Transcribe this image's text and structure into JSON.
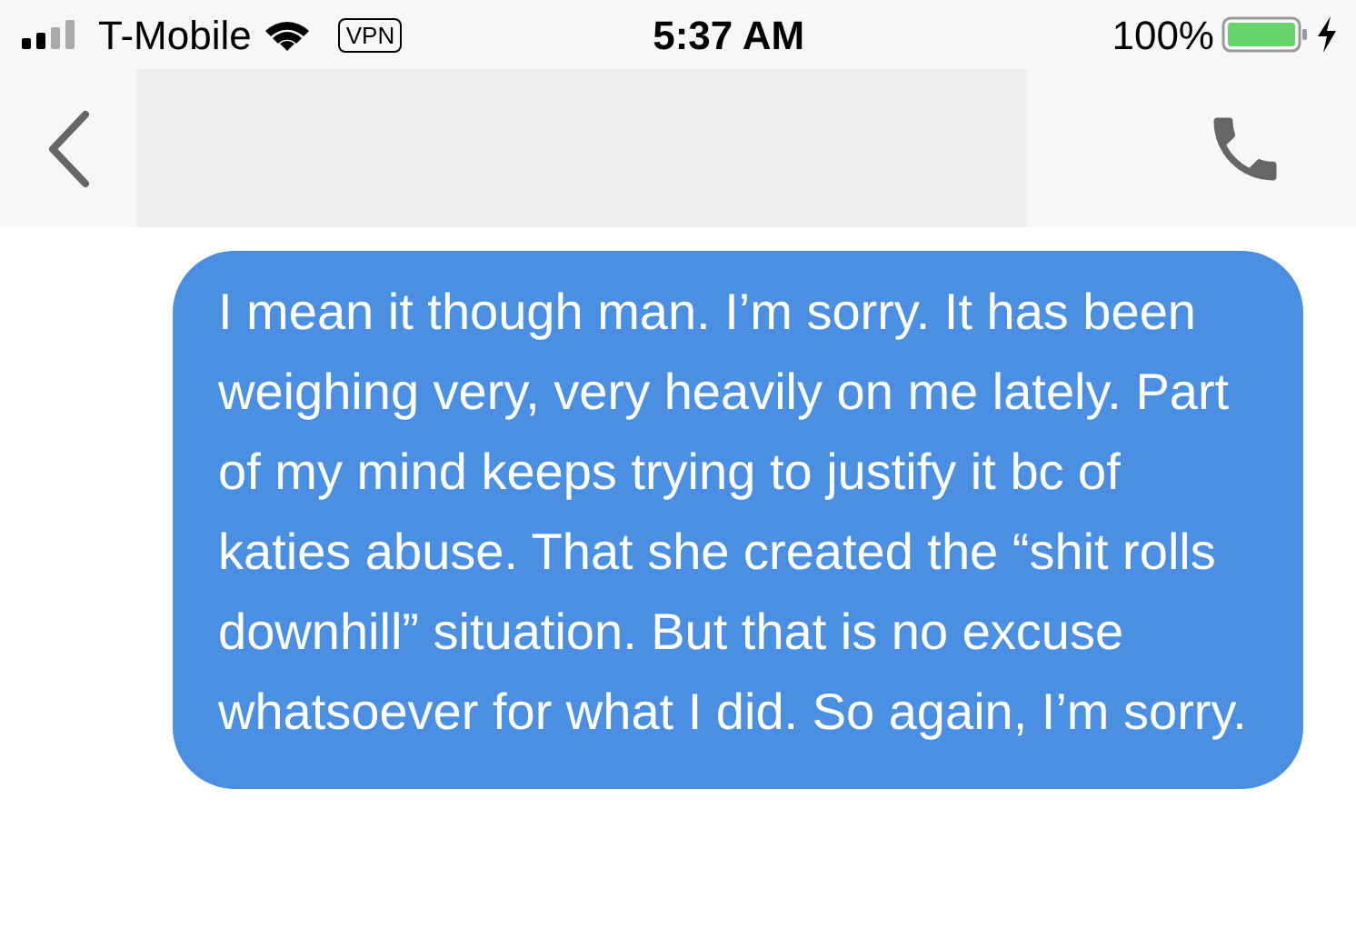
{
  "status_bar": {
    "carrier": "T-Mobile",
    "vpn": "VPN",
    "time": "5:37 AM",
    "battery": "100%"
  },
  "messages": [
    {
      "kind": "sent",
      "text": "I mean it though man. I’m sorry. It has been weighing very, very heavily on me lately. Part of my mind keeps trying to justify it bc of katies abuse. That she created the “shit rolls downhill” situation. But that is no excuse whatsoever for what I did. So again, I’m sorry."
    }
  ]
}
